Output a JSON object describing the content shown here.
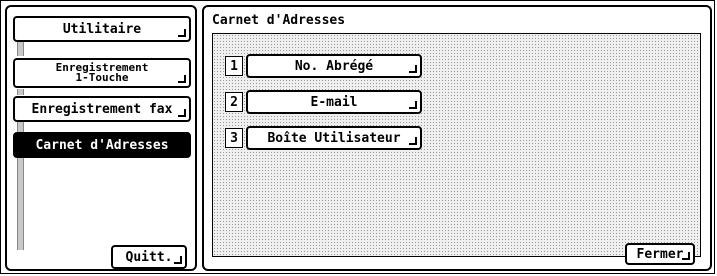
{
  "left_menu": {
    "items": [
      {
        "id": "utilitaire",
        "label": "Utilitaire"
      },
      {
        "id": "enregistrement-1touche",
        "line1": "Enregistrement",
        "line2": "1-Touche"
      },
      {
        "id": "enregistrement-fax",
        "label": "Enregistrement fax"
      },
      {
        "id": "carnet",
        "label": "Carnet d'Adresses",
        "selected": true
      }
    ],
    "quit_label": "Quitt."
  },
  "main": {
    "title": "Carnet d'Adresses",
    "options": [
      {
        "num": "1",
        "label": "No. Abrégé"
      },
      {
        "num": "2",
        "label": "E-mail"
      },
      {
        "num": "3",
        "label": "Boîte Utilisateur"
      }
    ],
    "close_label": "Fermer"
  }
}
